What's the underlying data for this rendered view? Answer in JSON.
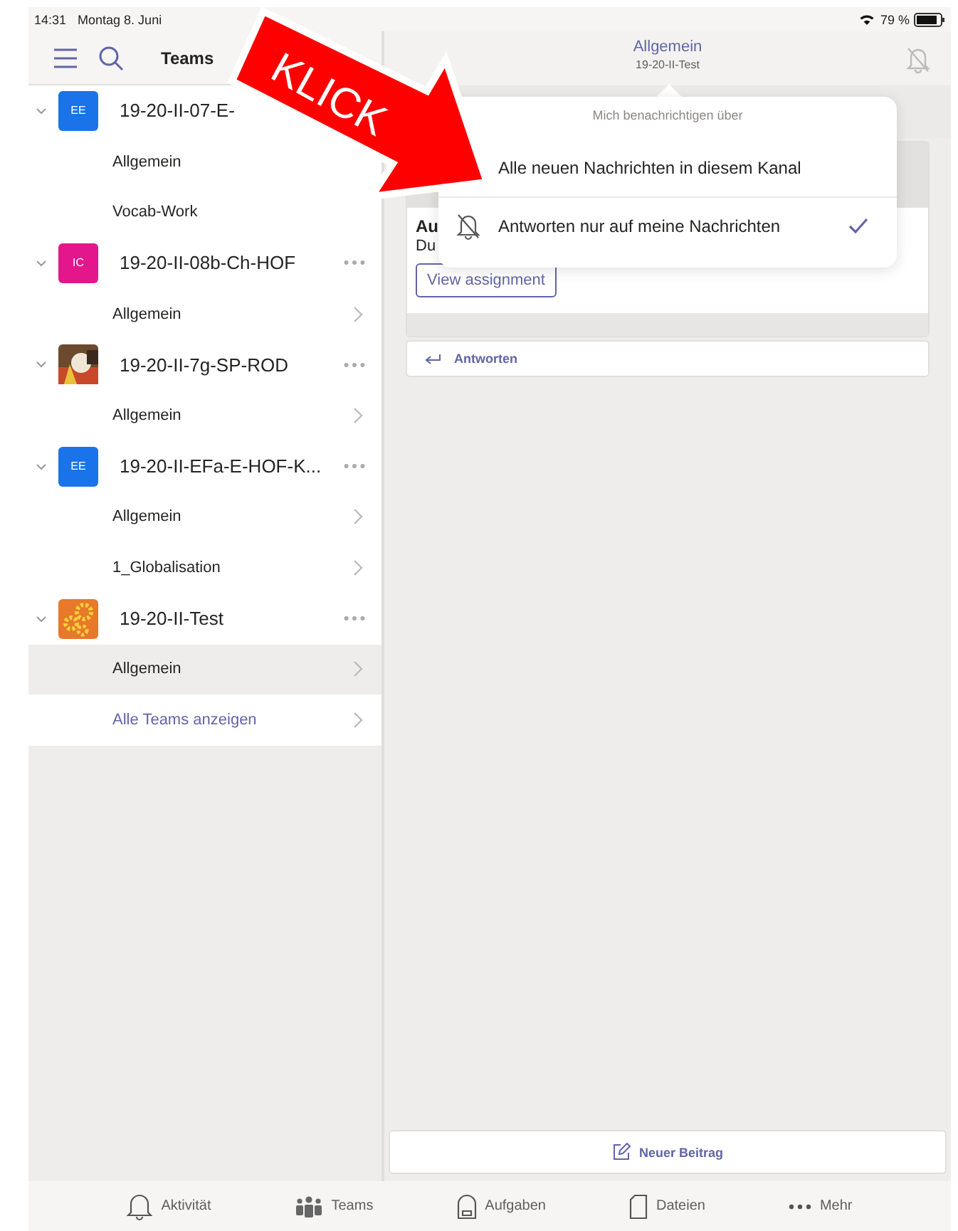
{
  "status_bar": {
    "time": "14:31",
    "date": "Montag 8. Juni",
    "battery": "79 %"
  },
  "sidebar": {
    "title": "Teams",
    "teams": [
      {
        "name": "19-20-II-07-E-",
        "expanded": true,
        "more": false,
        "avatar": {
          "kind": "initials",
          "text": "EE",
          "color": "#1a73e8"
        },
        "channels": [
          {
            "name": "Allgemein",
            "selected": false,
            "chevron": false
          },
          {
            "name": "Vocab-Work",
            "selected": false,
            "chevron": false
          }
        ]
      },
      {
        "name": "19-20-II-08b-Ch-HOF",
        "expanded": true,
        "more": true,
        "avatar": {
          "kind": "initials",
          "text": "IC",
          "color": "#e3168c"
        },
        "channels": [
          {
            "name": "Allgemein",
            "selected": false,
            "chevron": true
          }
        ]
      },
      {
        "name": "19-20-II-7g-SP-ROD",
        "expanded": true,
        "more": true,
        "avatar": {
          "kind": "picture"
        },
        "channels": [
          {
            "name": "Allgemein",
            "selected": false,
            "chevron": true
          }
        ]
      },
      {
        "name": "19-20-II-EFa-E-HOF-K...",
        "expanded": true,
        "more": true,
        "avatar": {
          "kind": "initials",
          "text": "EE",
          "color": "#1a73e8"
        },
        "channels": [
          {
            "name": "Allgemein",
            "selected": false,
            "chevron": true
          },
          {
            "name": "1_Globalisation",
            "selected": false,
            "chevron": true
          }
        ]
      },
      {
        "name": "19-20-II-Test",
        "expanded": true,
        "more": true,
        "avatar": {
          "kind": "gears",
          "color": "#e8782a"
        },
        "channels": [
          {
            "name": "Allgemein",
            "selected": true,
            "chevron": true
          }
        ]
      }
    ],
    "all_teams_link": "Alle Teams anzeigen"
  },
  "channel": {
    "title": "Allgemein",
    "subtitle": "19-20-II-Test"
  },
  "post": {
    "title": "Au",
    "due": "Du",
    "button": "View assignment",
    "reply": "Antworten"
  },
  "popover": {
    "heading": "Mich benachrichtigen über",
    "options": [
      {
        "label": "Alle neuen Nachrichten in diesem Kanal",
        "kind": "plain",
        "selected": false
      },
      {
        "label": "Antworten nur auf meine Nachrichten",
        "kind": "muted",
        "selected": true
      }
    ]
  },
  "new_post": "Neuer Beitrag",
  "annotation": "KLICK",
  "tabs": [
    {
      "label": "Aktivität"
    },
    {
      "label": "Teams"
    },
    {
      "label": "Aufgaben"
    },
    {
      "label": "Dateien"
    },
    {
      "label": "Mehr"
    }
  ]
}
